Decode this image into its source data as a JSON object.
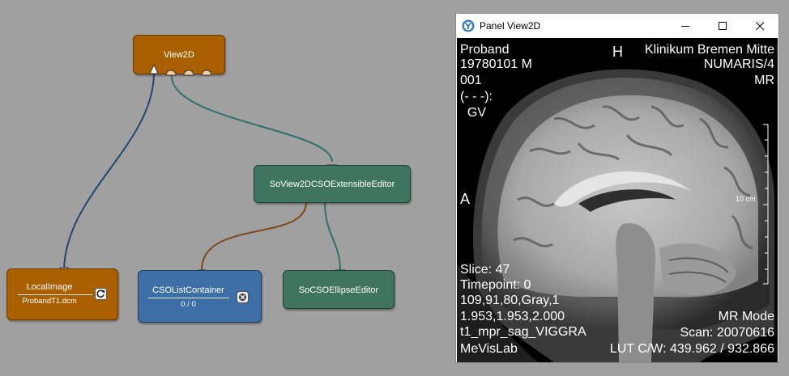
{
  "network": {
    "modules": {
      "view2d": {
        "title": "View2D"
      },
      "localimage": {
        "title": "LocalImage",
        "subtitle": "ProbandT1.dcm",
        "button_icon": "reload-icon"
      },
      "csolistcontainer": {
        "title": "CSOListContainer",
        "subtitle": "0 / 0",
        "button_icon": "clear-icon"
      },
      "extensibleeditor": {
        "title": "SoView2DCSOExtensibleEditor"
      },
      "ellipseeditor": {
        "title": "SoCSOEllipseEditor"
      }
    },
    "colors": {
      "background": "#a0a0a0",
      "module_orange": "#aa6000",
      "module_green": "#3f7460",
      "module_blue": "#3d6fa6",
      "connection_image": "#23456e",
      "connection_inventor": "#2f6f6a",
      "connection_base": "#7a4a1c"
    }
  },
  "panel": {
    "title": "Panel View2D",
    "icon": "mevislab-app-icon",
    "controls": [
      "minimize-icon",
      "maximize-icon",
      "close-icon"
    ],
    "viewer": {
      "top_left": [
        "Proband",
        "19780101  M",
        "001",
        "(- - -):",
        "  GV"
      ],
      "top_center": "H",
      "top_right": [
        "Klinikum Bremen Mitte",
        "NUMARIS/4",
        "MR"
      ],
      "left_orientation": "A",
      "scale_label": "10 cm",
      "bottom_left": [
        "Slice: 47",
        "Timepoint: 0",
        "109,91,80,Gray,1",
        "1.953,1.953,2.000",
        "t1_mpr_sag_VIGGRA",
        "MeVisLab"
      ],
      "bottom_right": [
        "MR Mode",
        "Scan: 20070616",
        "LUT C/W: 439.962 / 932.866"
      ]
    }
  }
}
